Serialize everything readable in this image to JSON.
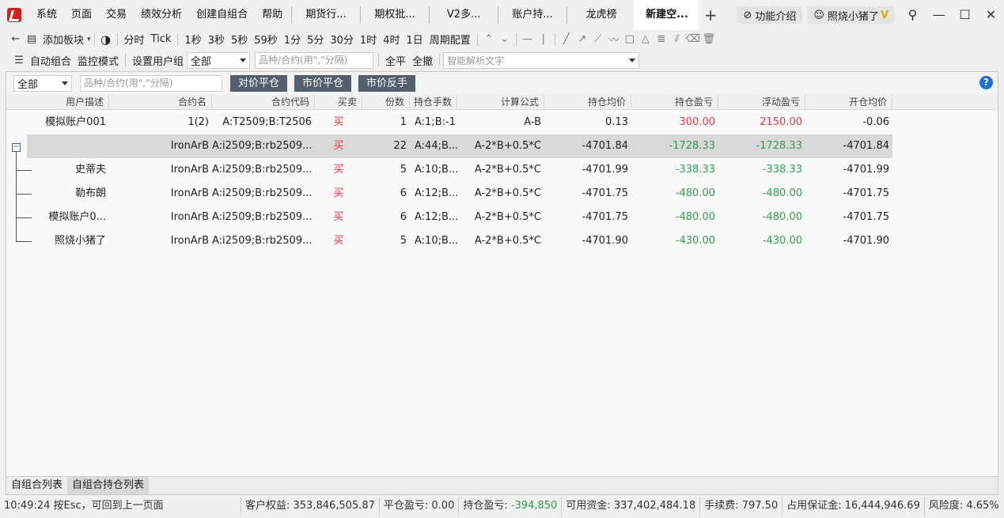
{
  "menu": [
    "系统",
    "页面",
    "交易",
    "绩效分析",
    "创建自组合",
    "帮助"
  ],
  "tabs": [
    {
      "label": "期货行...",
      "active": false
    },
    {
      "label": "期权批...",
      "active": false
    },
    {
      "label": "V2多...",
      "active": false
    },
    {
      "label": "账户持...",
      "active": false
    },
    {
      "label": "龙虎榜",
      "active": false
    },
    {
      "label": "新建空...",
      "active": true
    }
  ],
  "tab_add": "+",
  "title_right": {
    "feature_intro": "功能介绍",
    "user": "照烧小猪了",
    "vip_badge": "V"
  },
  "toolbar1": {
    "add_block": "添加板块",
    "timeframes": [
      "分时",
      "Tick",
      "1秒",
      "3秒",
      "5秒",
      "59秒",
      "1分",
      "5分",
      "30分",
      "1时",
      "4时",
      "1日",
      "周期配置"
    ]
  },
  "toolbar2": {
    "auto_combo": "自动组合",
    "monitor_mode": "监控模式",
    "set_user_group": "设置用户组",
    "group_select": "全部",
    "symbol_placeholder": "品种/合约(用\",\"分隔)",
    "close_all": "全平",
    "cancel_all": "全撤",
    "parse_placeholder": "智能解析文字"
  },
  "panel": {
    "filter_select": "全部",
    "filter_placeholder": "品种/合约(用\",\"分隔)",
    "buttons": [
      "对价平仓",
      "市价平仓",
      "市价反手"
    ],
    "help": "?"
  },
  "table": {
    "headers": [
      "用户描述",
      "合约名",
      "合约代码",
      "买卖",
      "份数",
      "持仓手数",
      "计算公式",
      "持仓均价",
      "持仓盈亏",
      "浮动盈亏",
      "开仓均价"
    ],
    "rows": [
      {
        "user": "模拟账户001",
        "name": "1(2)",
        "code": "A:T2509;B:T2506",
        "side": "买",
        "qty": "1",
        "hands": "A:1;B:-1",
        "formula": "A-B",
        "avg": "0.13",
        "pnl": "300.00",
        "float_pnl": "2150.00",
        "open_avg": "-0.06",
        "pnl_color": "red",
        "float_color": "red"
      },
      {
        "user": "",
        "name": "IronArB",
        "code": "A:i2509;B:rb2509...",
        "side": "买",
        "qty": "22",
        "hands": "A:44;B...",
        "formula": "A-2*B+0.5*C",
        "avg": "-4701.84",
        "pnl": "-1728.33",
        "float_pnl": "-1728.33",
        "open_avg": "-4701.84",
        "pnl_color": "green",
        "float_color": "green"
      },
      {
        "user": "史蒂夫",
        "name": "IronArB",
        "code": "A:i2509;B:rb2509...",
        "side": "买",
        "qty": "5",
        "hands": "A:10;B...",
        "formula": "A-2*B+0.5*C",
        "avg": "-4701.99",
        "pnl": "-338.33",
        "float_pnl": "-338.33",
        "open_avg": "-4701.99",
        "pnl_color": "green",
        "float_color": "green"
      },
      {
        "user": "勒布朗",
        "name": "IronArB",
        "code": "A:i2509;B:rb2509...",
        "side": "买",
        "qty": "6",
        "hands": "A:12;B...",
        "formula": "A-2*B+0.5*C",
        "avg": "-4701.75",
        "pnl": "-480.00",
        "float_pnl": "-480.00",
        "open_avg": "-4701.75",
        "pnl_color": "green",
        "float_color": "green"
      },
      {
        "user": "模拟账户0...",
        "name": "IronArB",
        "code": "A:i2509;B:rb2509...",
        "side": "买",
        "qty": "6",
        "hands": "A:12;B...",
        "formula": "A-2*B+0.5*C",
        "avg": "-4701.75",
        "pnl": "-480.00",
        "float_pnl": "-480.00",
        "open_avg": "-4701.75",
        "pnl_color": "green",
        "float_color": "green"
      },
      {
        "user": "照烧小猪了",
        "name": "IronArB",
        "code": "A:i2509;B:rb2509...",
        "side": "买",
        "qty": "5",
        "hands": "A:10;B...",
        "formula": "A-2*B+0.5*C",
        "avg": "-4701.90",
        "pnl": "-430.00",
        "float_pnl": "-430.00",
        "open_avg": "-4701.90",
        "pnl_color": "green",
        "float_color": "green"
      }
    ]
  },
  "bottom_tabs": [
    {
      "label": "自组合列表",
      "active": false
    },
    {
      "label": "自组合持仓列表",
      "active": true
    }
  ],
  "status": {
    "time_hint": "10:49:24 按Esc，可回到上一页面",
    "equity": "客户权益: 353,846,505.87",
    "close_pnl": "平仓盈亏: 0.00",
    "hold_pnl_label": "持仓盈亏: ",
    "hold_pnl_value": "-394,850",
    "available": "可用资金: 337,402,484.18",
    "fee": "手续费: 797.50",
    "margin": "占用保证金: 16,444,946.69",
    "risk": "风险度: 4.65%"
  },
  "colors": {
    "red": "#e23b3b",
    "green": "#2f9e4f",
    "button": "#52606e",
    "help": "#1a6fd8",
    "logo": "#d42020"
  }
}
